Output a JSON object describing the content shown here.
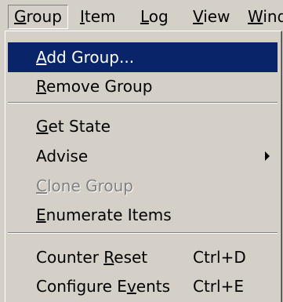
{
  "menubar": {
    "items": [
      {
        "pre": "",
        "key": "G",
        "post": "roup"
      },
      {
        "pre": "",
        "key": "I",
        "post": "tem"
      },
      {
        "pre": "",
        "key": "L",
        "post": "og"
      },
      {
        "pre": "",
        "key": "V",
        "post": "iew"
      },
      {
        "pre": "",
        "key": "W",
        "post": "ind"
      }
    ]
  },
  "menu": {
    "items": [
      {
        "pre": "",
        "key": "A",
        "post": "dd Group...",
        "shortcut": ""
      },
      {
        "pre": "",
        "key": "R",
        "post": "emove Group",
        "shortcut": ""
      },
      {
        "pre": "",
        "key": "G",
        "post": "et State",
        "shortcut": ""
      },
      {
        "pre": "Advise",
        "key": "",
        "post": "",
        "shortcut": ""
      },
      {
        "pre": "",
        "key": "C",
        "post": "lone Group",
        "shortcut": ""
      },
      {
        "pre": "",
        "key": "E",
        "post": "numerate Items",
        "shortcut": ""
      },
      {
        "pre": "Counter ",
        "key": "R",
        "post": "eset",
        "shortcut": "Ctrl+D"
      },
      {
        "pre": "Configure E",
        "key": "v",
        "post": "ents",
        "shortcut": "Ctrl+E"
      }
    ]
  },
  "colors": {
    "highlight": "#0a246a",
    "menu_bg": "#d4d0c8",
    "disabled_text": "#808080"
  }
}
